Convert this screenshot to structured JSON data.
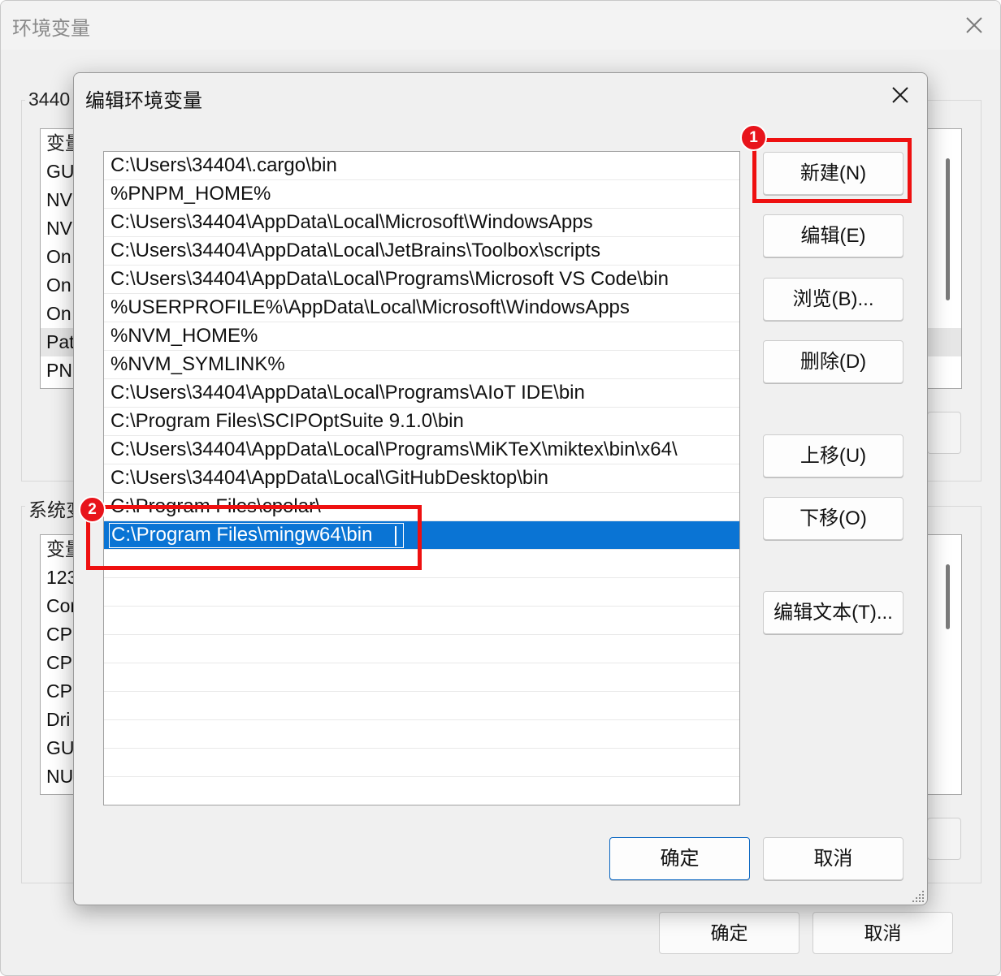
{
  "background_window": {
    "title": "环境变量",
    "user_group_label": "3440",
    "user_vars": [
      "变量",
      "GU",
      "NV",
      "NV",
      "On",
      "On",
      "On",
      "Pat",
      "PN"
    ],
    "system_group_label": "系统变",
    "system_vars": [
      "变量",
      "123",
      "Cor",
      "CPI",
      "CPI",
      "CP(",
      "Dri",
      "GU",
      "NU"
    ],
    "ok_label": "确定",
    "cancel_label": "取消"
  },
  "dialog": {
    "title": "编辑环境变量",
    "paths": [
      "C:\\Users\\34404\\.cargo\\bin",
      "%PNPM_HOME%",
      "C:\\Users\\34404\\AppData\\Local\\Microsoft\\WindowsApps",
      "C:\\Users\\34404\\AppData\\Local\\JetBrains\\Toolbox\\scripts",
      "C:\\Users\\34404\\AppData\\Local\\Programs\\Microsoft VS Code\\bin",
      "%USERPROFILE%\\AppData\\Local\\Microsoft\\WindowsApps",
      "%NVM_HOME%",
      "%NVM_SYMLINK%",
      "C:\\Users\\34404\\AppData\\Local\\Programs\\AIoT IDE\\bin",
      "C:\\Program Files\\SCIPOptSuite 9.1.0\\bin",
      "C:\\Users\\34404\\AppData\\Local\\Programs\\MiKTeX\\miktex\\bin\\x64\\",
      "C:\\Users\\34404\\AppData\\Local\\GitHubDesktop\\bin",
      "C:\\Program Files\\cpolar\\"
    ],
    "editing_value": "C:\\Program Files\\mingw64\\bin",
    "buttons": {
      "new": "新建(N)",
      "edit": "编辑(E)",
      "browse": "浏览(B)...",
      "delete": "删除(D)",
      "move_up": "上移(U)",
      "move_down": "下移(O)",
      "edit_text": "编辑文本(T)...",
      "ok": "确定",
      "cancel": "取消"
    }
  },
  "annotations": {
    "badge_1": "1",
    "badge_2": "2",
    "color": "#ee1010"
  }
}
